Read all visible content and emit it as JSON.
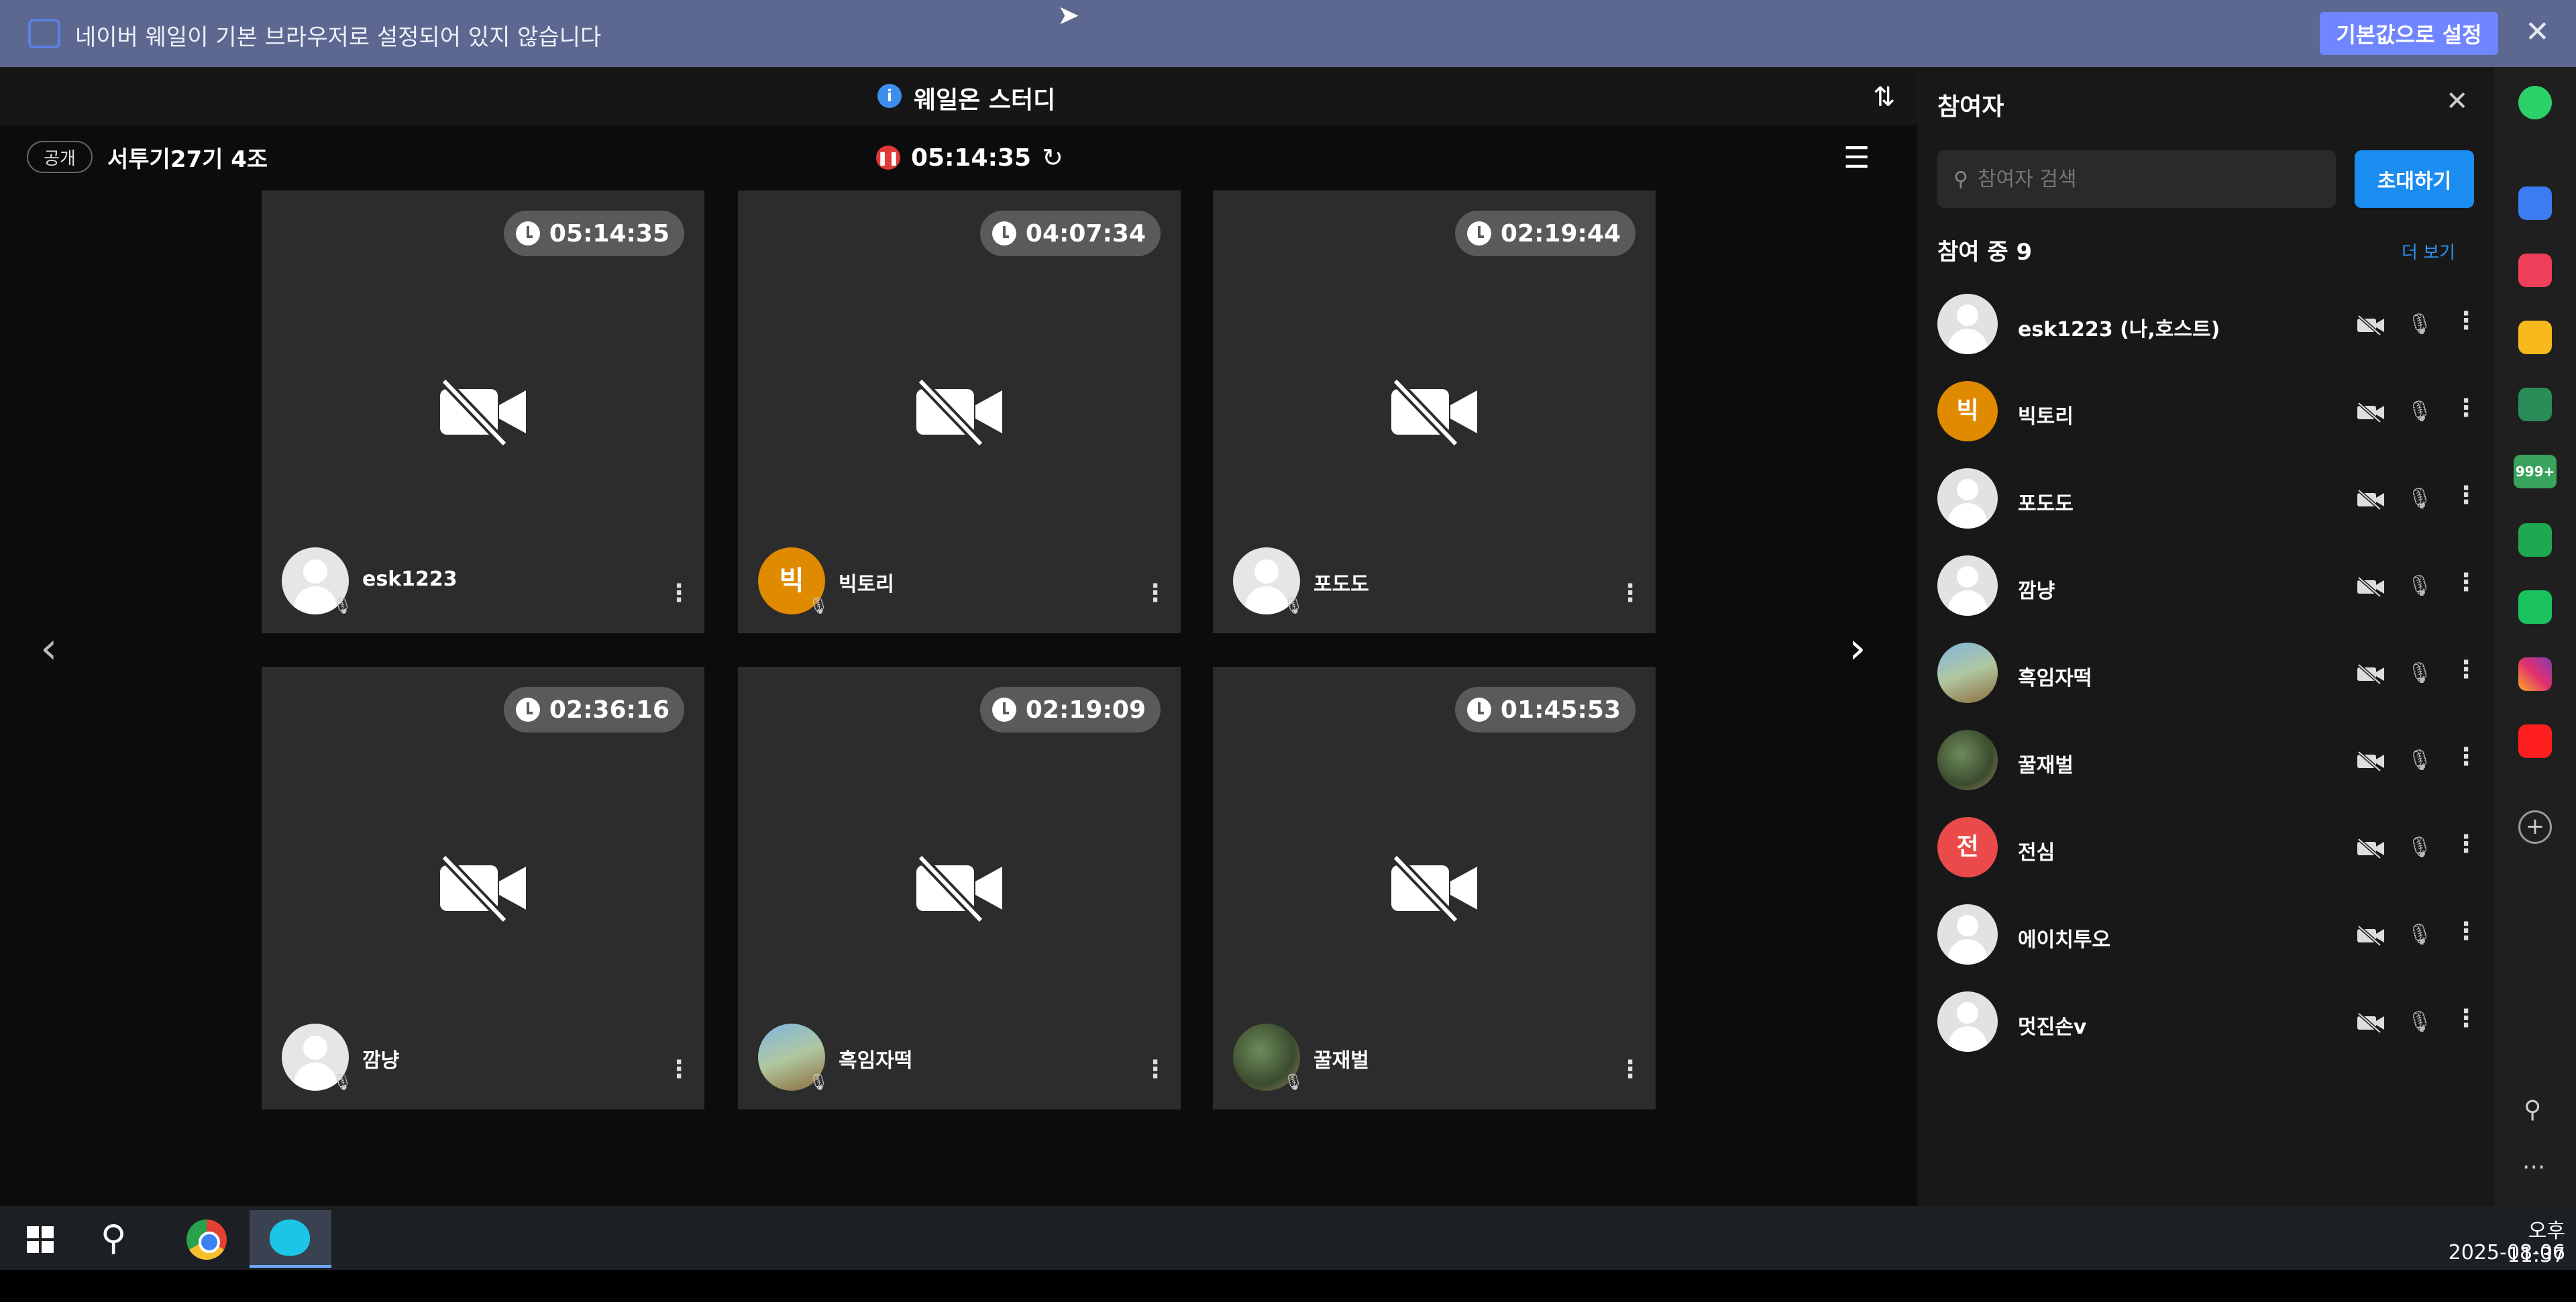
{
  "infobar": {
    "message": "네이버 웨일이 기본 브라우저로 설정되어 있지 않습니다",
    "default_button": "기본값으로 설정",
    "close": "✕"
  },
  "header": {
    "title": "웨일온 스터디",
    "info_icon": "i",
    "sort_icon": "sort-icon"
  },
  "room": {
    "visibility": "공개",
    "name": "서투기27기 4조",
    "elapsed": "05:14:35"
  },
  "tiles": [
    {
      "time": "05:14:35",
      "name": "esk1223",
      "avatar": "default"
    },
    {
      "time": "04:07:34",
      "name": "빅토리",
      "avatar": "letter",
      "letter": "빅"
    },
    {
      "time": "02:19:44",
      "name": "포도도",
      "avatar": "default"
    },
    {
      "time": "02:36:16",
      "name": "깜냥",
      "avatar": "default"
    },
    {
      "time": "02:19:09",
      "name": "흑임자떡",
      "avatar": "photo1"
    },
    {
      "time": "01:45:53",
      "name": "꿀재벌",
      "avatar": "photo2"
    }
  ],
  "panel": {
    "title": "참여자",
    "search_placeholder": "참여자 검색",
    "invite": "초대하기",
    "count_label": "참여 중 9",
    "more": "더 보기",
    "participants": [
      {
        "name": "esk1223 (나,호스트)",
        "avatar": "default"
      },
      {
        "name": "빅토리",
        "avatar": "letter",
        "letter": "빅",
        "color": "#e08a00"
      },
      {
        "name": "포도도",
        "avatar": "default"
      },
      {
        "name": "깜냥",
        "avatar": "default"
      },
      {
        "name": "흑임자떡",
        "avatar": "photo1"
      },
      {
        "name": "꿀재벌",
        "avatar": "photo2"
      },
      {
        "name": "전심",
        "avatar": "letter",
        "letter": "전",
        "color": "#ea4a4a"
      },
      {
        "name": "에이치투오",
        "avatar": "default"
      },
      {
        "name": "멋진손v",
        "avatar": "default"
      }
    ]
  },
  "sidebar": {
    "badge": "999+",
    "apps": [
      "green-circle-icon",
      "briefcase-icon",
      "pocket-icon",
      "star-icon",
      "translate-icon",
      "mail-icon",
      "stock-icon",
      "webtoon-icon",
      "instagram-icon",
      "youtube-icon"
    ]
  },
  "taskbar": {
    "time": "오후 11:37",
    "date": "2025-08-06"
  },
  "colors": {
    "accent": "#1b8cf0",
    "infobar": "#5c6890",
    "tile": "#2c2c2c",
    "recording": "#e03a3a"
  }
}
